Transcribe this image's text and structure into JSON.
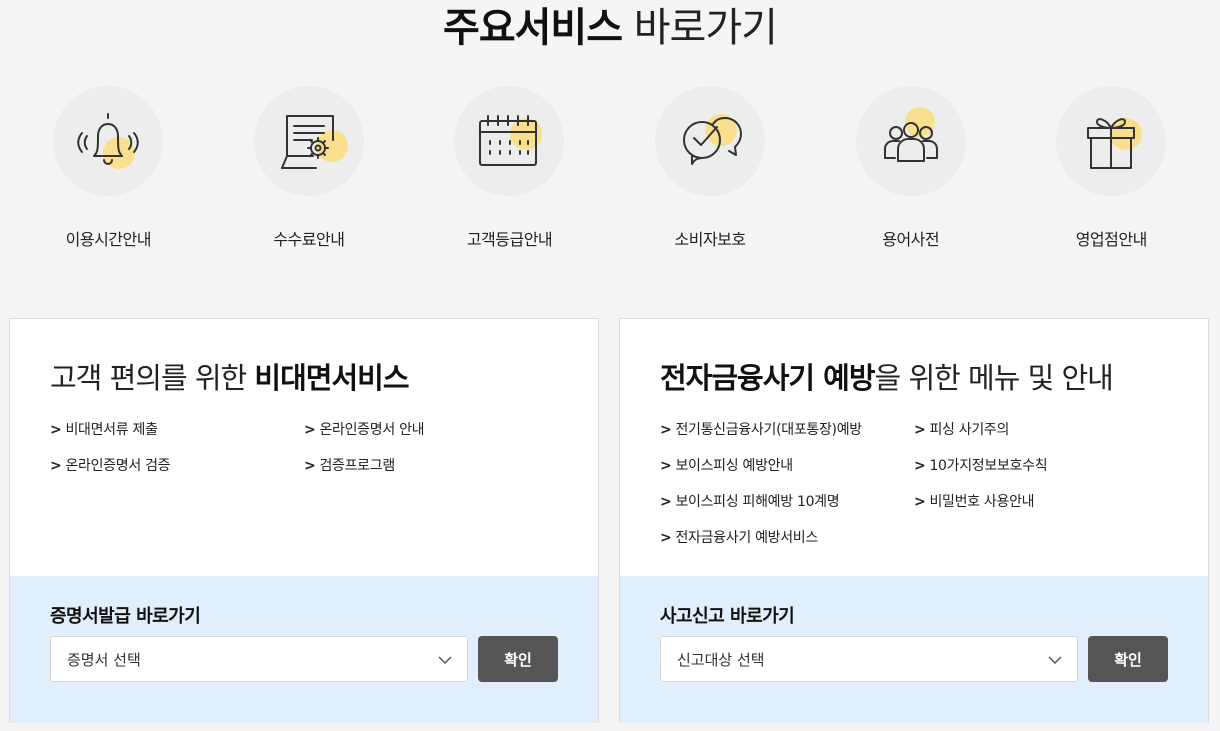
{
  "header": {
    "title_strong": "주요서비스",
    "title_light": " 바로가기"
  },
  "services": [
    {
      "label": "이용시간안내",
      "icon": "bell-icon"
    },
    {
      "label": "수수료안내",
      "icon": "fee-document-icon"
    },
    {
      "label": "고객등급안내",
      "icon": "calendar-icon"
    },
    {
      "label": "소비자보호",
      "icon": "speech-check-icon"
    },
    {
      "label": "용어사전",
      "icon": "people-icon"
    },
    {
      "label": "영업점안내",
      "icon": "gift-icon"
    }
  ],
  "left_panel": {
    "title_prefix": "고객 편의를 위한 ",
    "title_strong": "비대면서비스",
    "links": [
      "비대면서류 제출",
      "온라인증명서 안내",
      "온라인증명서 검증",
      "검증프로그램"
    ],
    "bottom_title": "증명서발급 바로가기",
    "select_value": "증명서 선택",
    "button_label": "확인"
  },
  "right_panel": {
    "title_strong": "전자금융사기 예방",
    "title_suffix": "을 위한 메뉴 및 안내",
    "links": [
      "전기통신금융사기(대포통장)예방",
      "피싱 사기주의",
      "보이스피싱 예방안내",
      "10가지정보보호수칙",
      "보이스피싱 피해예방 10계명",
      "비밀번호 사용안내",
      "전자금융사기 예방서비스"
    ],
    "bottom_title": "사고신고 바로가기",
    "select_value": "신고대상 선택",
    "button_label": "확인"
  },
  "link_arrow": ">",
  "colors": {
    "accent_yellow": "#f9e08e",
    "page_bg": "#f5f5f5",
    "panel_bottom_bg": "#e1eefb",
    "button_bg": "#555555"
  }
}
